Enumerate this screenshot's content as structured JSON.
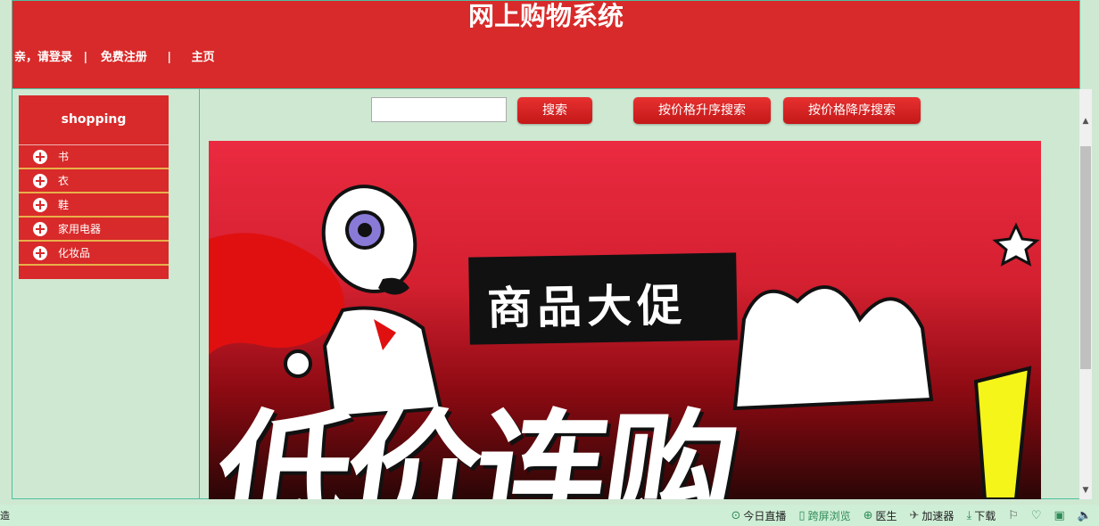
{
  "header": {
    "title": "网上购物系统",
    "nav": {
      "login": "亲，请登录",
      "sep1": "|",
      "register": "免费注册",
      "sep2": "|",
      "home": "主页"
    }
  },
  "sidebar": {
    "title": "shopping",
    "items": [
      {
        "label": "书"
      },
      {
        "label": "衣"
      },
      {
        "label": "鞋"
      },
      {
        "label": "家用电器"
      },
      {
        "label": "化妆品"
      }
    ]
  },
  "toolbar": {
    "search_value": "",
    "search_button": "搜索",
    "price_asc_button": "按价格升序搜索",
    "price_desc_button": "按价格降序搜索"
  },
  "banner": {
    "label_text": "商品大促",
    "big_text": "低价连购"
  },
  "status_bar": {
    "left_text": "造",
    "items": [
      {
        "label": "今日直播",
        "icon": "play-circle-icon"
      },
      {
        "label": "跨屏浏览",
        "icon": "phone-icon"
      },
      {
        "label": "医生",
        "icon": "plus-circle-icon"
      },
      {
        "label": "加速器",
        "icon": "rocket-icon"
      },
      {
        "label": "下载",
        "icon": "download-icon"
      }
    ]
  }
}
